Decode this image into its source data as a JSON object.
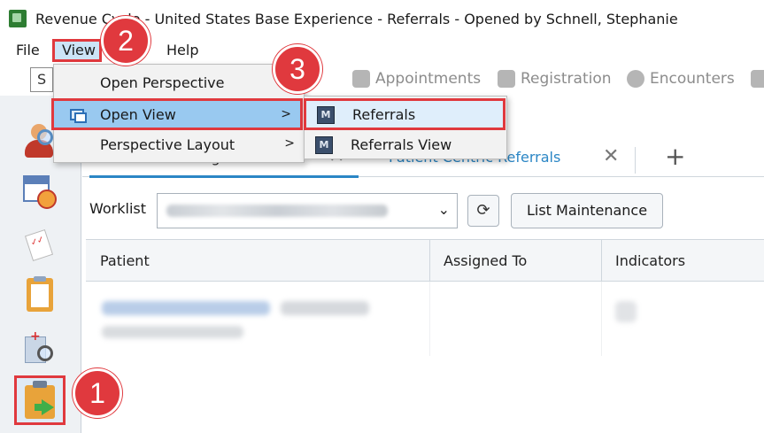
{
  "window": {
    "title": "Revenue Cycle - United States Base Experience - Referrals - Opened by Schnell, Stephanie",
    "app_icon": "revenue-cycle-app-icon"
  },
  "menubar": {
    "items": [
      {
        "label": "File"
      },
      {
        "label": "View"
      },
      {
        "label": "Help"
      }
    ]
  },
  "toolbar": {
    "search_stub": "S",
    "buttons": [
      {
        "label": "Appointments",
        "icon": "appointments-icon"
      },
      {
        "label": "Registration",
        "icon": "registration-icon"
      },
      {
        "label": "Encounters",
        "icon": "encounters-icon"
      }
    ]
  },
  "view_menu": {
    "items": [
      {
        "label": "Open Perspective",
        "has_submenu": false
      },
      {
        "label": "Open View",
        "has_submenu": true,
        "arrow": ">",
        "highlighted": true
      },
      {
        "label": "Perspective Layout",
        "has_submenu": true,
        "arrow": ">"
      }
    ]
  },
  "open_view_submenu": {
    "items": [
      {
        "label": "Referrals",
        "icon_glyph": "M",
        "highlighted": true
      },
      {
        "label": "Referrals View",
        "icon_glyph": "M"
      }
    ]
  },
  "tabs": [
    {
      "label": "Referral Management",
      "active": true,
      "close": "✕"
    },
    {
      "label": "Patient Centric Referrals",
      "active": false,
      "close": "✕"
    }
  ],
  "tab_add": "+",
  "worklist": {
    "label": "Worklist",
    "chevron": "⌄",
    "refresh_glyph": "⟳",
    "list_maintenance_label": "List Maintenance"
  },
  "grid": {
    "columns": [
      "Patient",
      "Assigned To",
      "Indicators"
    ]
  },
  "steps": [
    "1",
    "2",
    "3"
  ],
  "colors": {
    "highlight_red": "#e0393e",
    "menu_selected_blue": "#99c9f0",
    "tab_active_blue": "#2b86c5"
  }
}
